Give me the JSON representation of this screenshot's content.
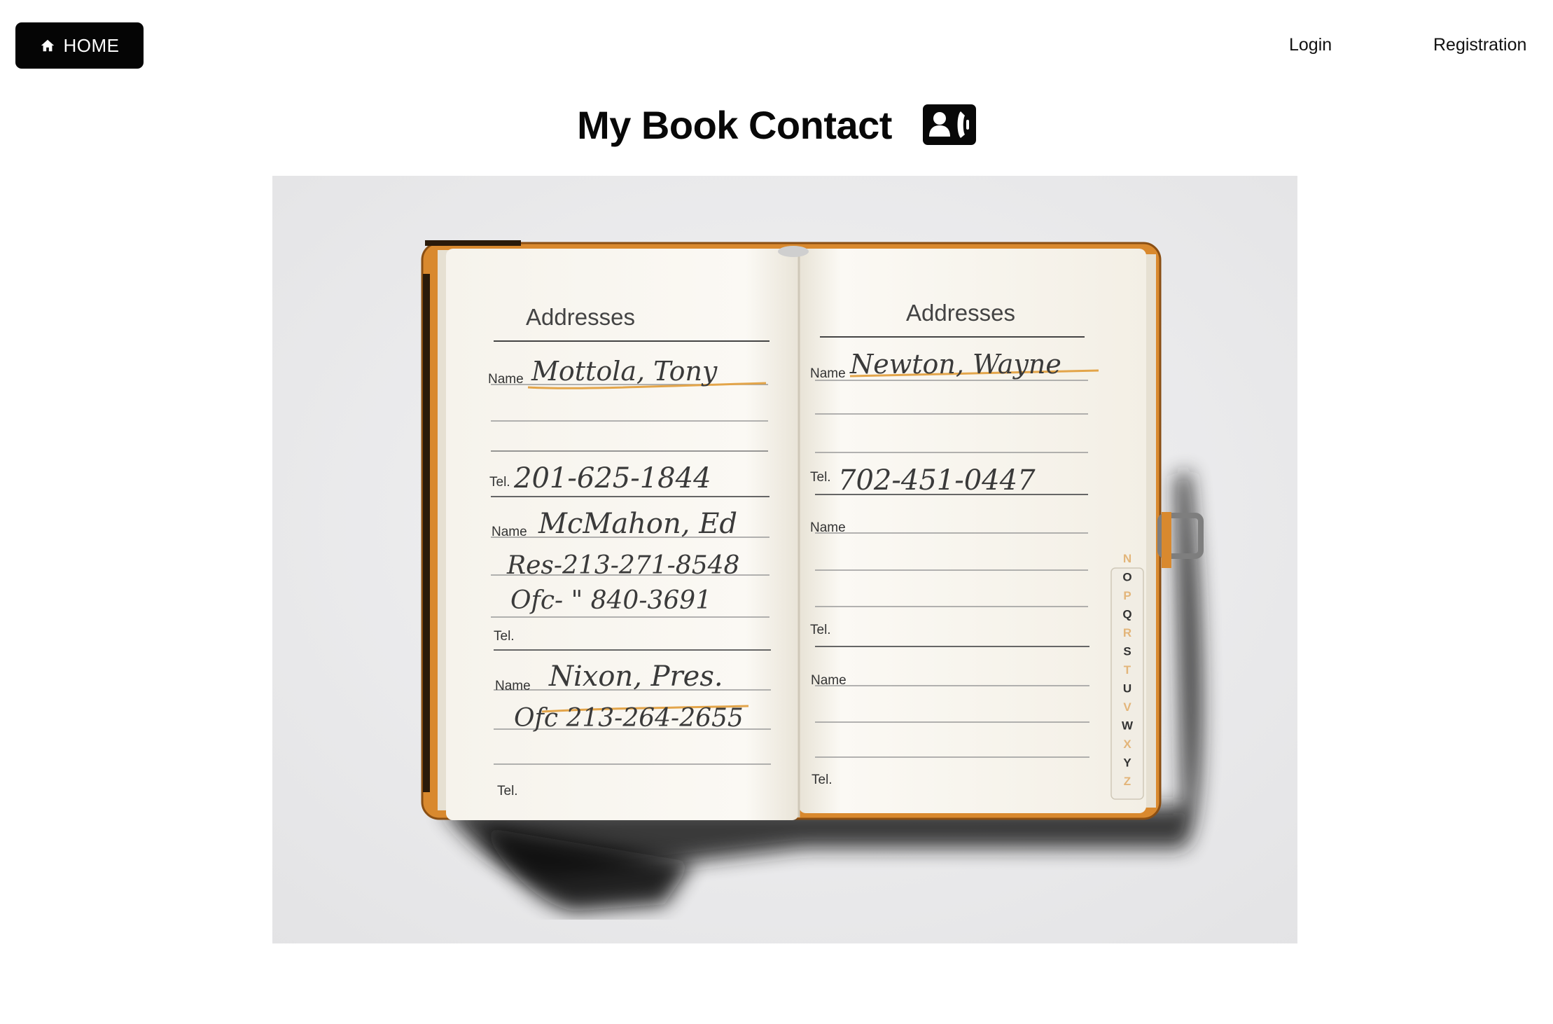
{
  "nav": {
    "home_label": "HOME",
    "home_icon": "home-icon",
    "login_label": "Login",
    "registration_label": "Registration"
  },
  "header": {
    "title": "My Book Contact",
    "icon": "contact-card-phone-icon"
  },
  "hero_image": {
    "left_page": {
      "heading": "Addresses",
      "name_label": "Name",
      "tel_label": "Tel.",
      "entries": [
        {
          "name": "Mottola, Tony",
          "tel": "201-625-1844"
        },
        {
          "name": "McMahon, Ed",
          "res": "Res-213-271-8548",
          "ofc": "Ofc-  \"  840-3691"
        },
        {
          "name": "Nixon, Pres.",
          "ofc": "Ofc 213-264-2655"
        }
      ]
    },
    "right_page": {
      "heading": "Addresses",
      "name_label": "Name",
      "tel_label": "Tel.",
      "entries": [
        {
          "name": "Newton, Wayne",
          "tel": "702-451-0447"
        }
      ]
    },
    "index_tabs": [
      "N",
      "O",
      "P",
      "Q",
      "R",
      "S",
      "T",
      "U",
      "V",
      "W",
      "X",
      "Y",
      "Z"
    ]
  },
  "colors": {
    "button_bg": "#050505",
    "button_text": "#ffffff",
    "image_bg": "#e9e9eb",
    "leather": "#d9892e"
  }
}
